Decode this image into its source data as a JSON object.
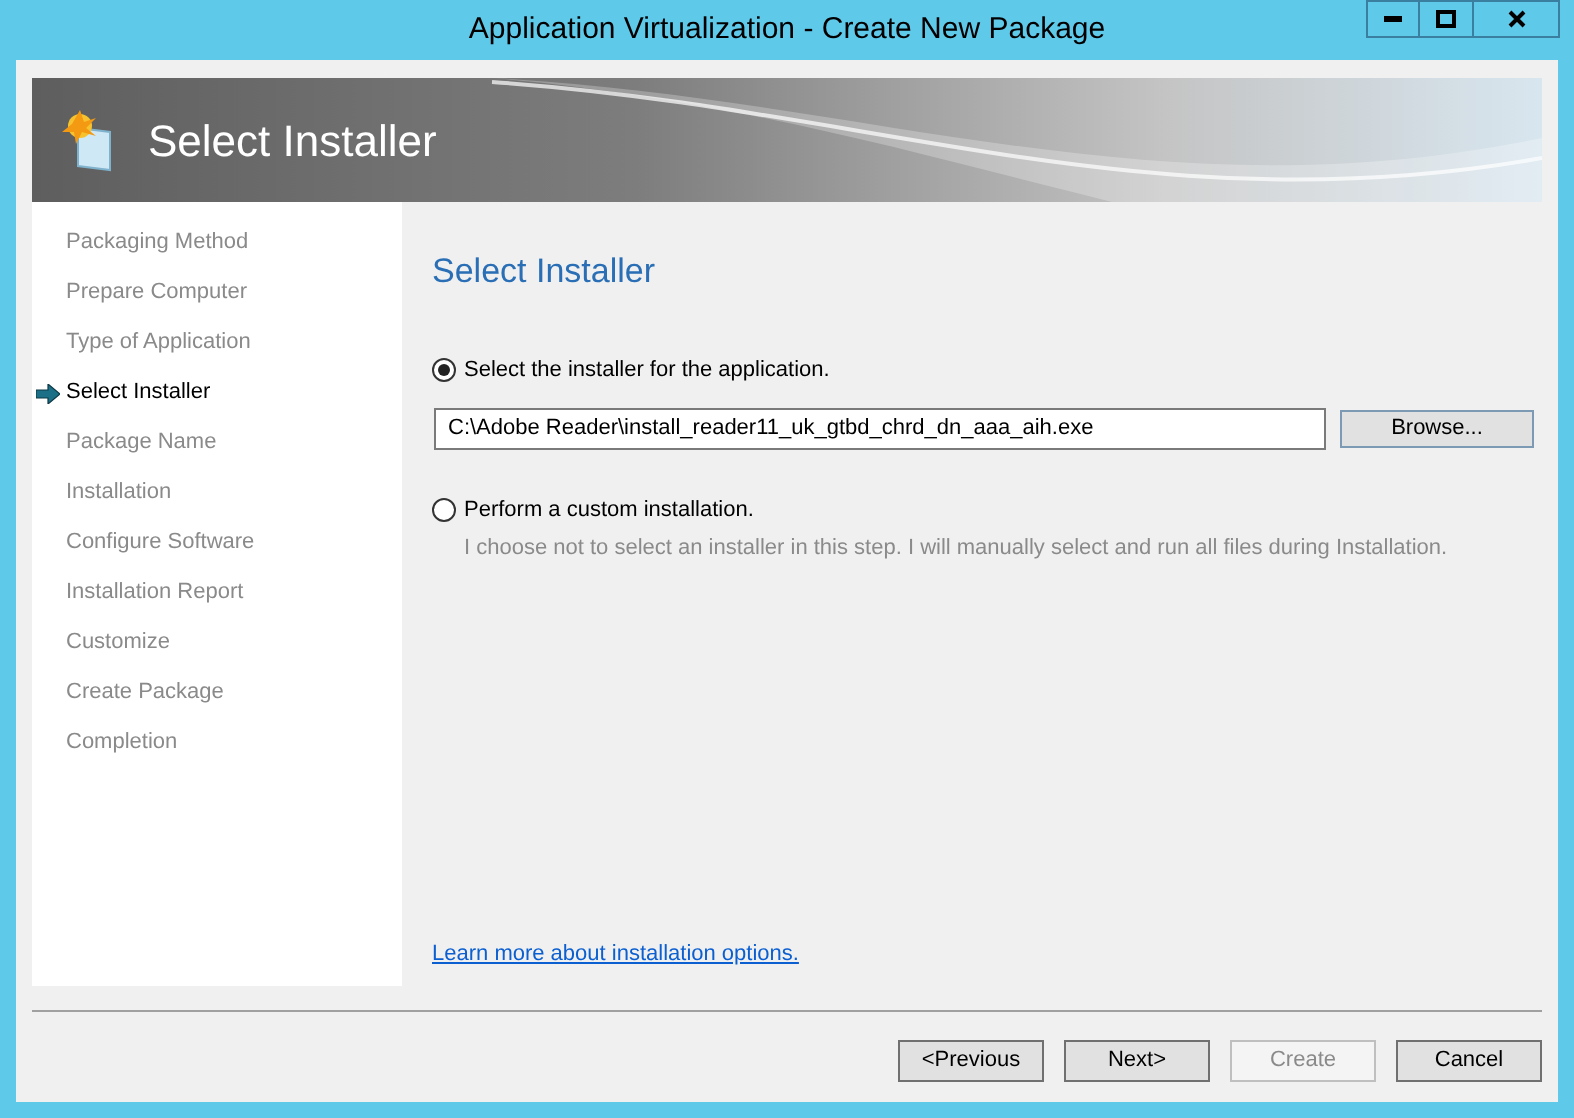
{
  "window": {
    "title": "Application Virtualization - Create New Package"
  },
  "banner": {
    "title": "Select Installer"
  },
  "steps": [
    {
      "label": "Packaging Method",
      "selected": false
    },
    {
      "label": "Prepare Computer",
      "selected": false
    },
    {
      "label": "Type of Application",
      "selected": false
    },
    {
      "label": "Select Installer",
      "selected": true
    },
    {
      "label": "Package Name",
      "selected": false
    },
    {
      "label": "Installation",
      "selected": false
    },
    {
      "label": "Configure Software",
      "selected": false
    },
    {
      "label": "Installation Report",
      "selected": false
    },
    {
      "label": "Customize",
      "selected": false
    },
    {
      "label": "Create Package",
      "selected": false
    },
    {
      "label": "Completion",
      "selected": false
    }
  ],
  "page": {
    "heading": "Select Installer",
    "options": [
      {
        "label": "Select the installer for the application.",
        "selected": true,
        "path": "C:\\Adobe Reader\\install_reader11_uk_gtbd_chrd_dn_aaa_aih.exe",
        "browse": "Browse..."
      },
      {
        "label": "Perform a custom installation.",
        "selected": false,
        "description": "I choose not to select an installer in this step.  I will manually select and run all files during Installation."
      }
    ],
    "link": "Learn more about installation options."
  },
  "buttons": [
    {
      "label": "<Previous",
      "disabled": false
    },
    {
      "label": "Next>",
      "disabled": false
    },
    {
      "label": "Create",
      "disabled": true
    },
    {
      "label": "Cancel",
      "disabled": false
    }
  ]
}
